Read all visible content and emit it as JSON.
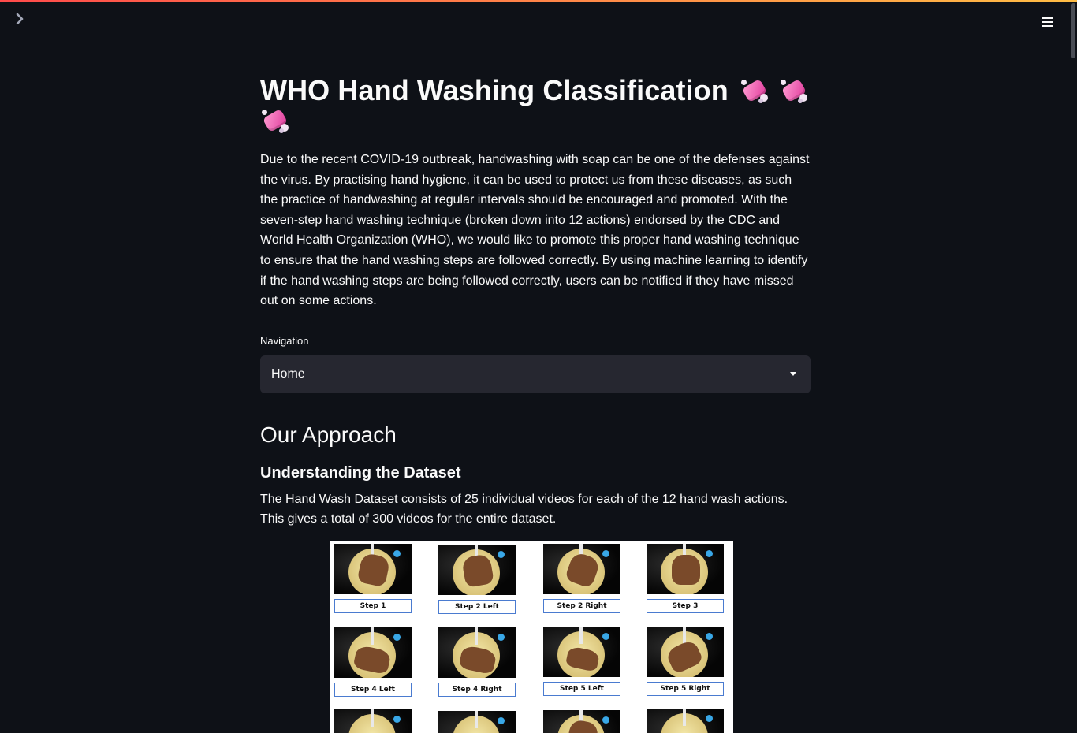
{
  "title": "WHO Hand Washing Classification",
  "intro": "Due to the recent COVID-19 outbreak, handwashing with soap can be one of the defenses against the virus. By practising hand hygiene, it can be used to protect us from these diseases, as such the practice of handwashing at regular intervals should be encouraged and promoted. With the seven-step hand washing technique (broken down into 12 actions) endorsed by the CDC and World Health Organization (WHO), we would like to promote this proper hand washing technique to ensure that the hand washing steps are followed correctly. By using machine learning to identify if the hand washing steps are being followed correctly, users can be notified if they have missed out on some actions.",
  "navigation": {
    "label": "Navigation",
    "selected": "Home"
  },
  "approach": {
    "heading": "Our Approach",
    "subheading": "Understanding the Dataset",
    "text": "The Hand Wash Dataset consists of 25 individual videos for each of the 12 hand wash actions. This gives a total of 300 videos for the entire dataset."
  },
  "steps": [
    "Step 1",
    "Step 2 Left",
    "Step 2 Right",
    "Step 3",
    "Step 4 Left",
    "Step 4 Right",
    "Step 5 Left",
    "Step 5 Right"
  ],
  "icons": {
    "sidebar_toggle": "chevron-right-icon",
    "menu": "hamburger-menu-icon",
    "title_emoji": "soap-icon"
  },
  "colors": {
    "background": "#0e1117",
    "select_background": "#262730",
    "accent_gradient_start": "#ff4b4b",
    "accent_gradient_end": "#ffbd45"
  }
}
